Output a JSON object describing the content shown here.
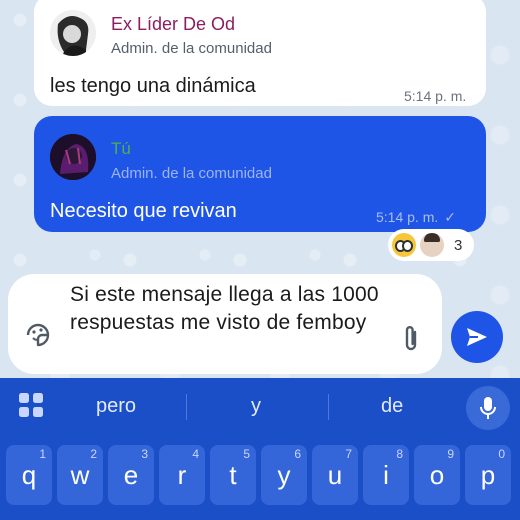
{
  "messages": {
    "incoming": {
      "sender": "Ex Líder De Od",
      "role": "Admin. de la comunidad",
      "text": "les tengo una dinámica",
      "time": "5:14 p. m."
    },
    "outgoing": {
      "sender": "Tú",
      "role": "Admin. de la comunidad",
      "text": "Necesito que revivan",
      "time": "5:14 p. m.",
      "check": "✓",
      "reactions": {
        "count": "3"
      }
    }
  },
  "composer": {
    "text": "Si este mensaje llega a las 1000 respuestas me visto de femboy"
  },
  "keyboard": {
    "suggestions": [
      "pero",
      "y",
      "de"
    ],
    "keys": [
      {
        "label": "q",
        "num": "1"
      },
      {
        "label": "w",
        "num": "2"
      },
      {
        "label": "e",
        "num": "3"
      },
      {
        "label": "r",
        "num": "4"
      },
      {
        "label": "t",
        "num": "5"
      },
      {
        "label": "y",
        "num": "6"
      },
      {
        "label": "u",
        "num": "7"
      },
      {
        "label": "i",
        "num": "8"
      },
      {
        "label": "o",
        "num": "9"
      },
      {
        "label": "p",
        "num": "0"
      }
    ]
  },
  "colors": {
    "accent": "#1f55e6",
    "keyboard_bg": "#1a4fc8",
    "sender_in": "#8b1e5f",
    "sender_out": "#4caf50"
  },
  "icons": [
    "sticker-icon",
    "attach-icon",
    "send-icon",
    "grid-icon",
    "mic-icon",
    "check-icon"
  ]
}
